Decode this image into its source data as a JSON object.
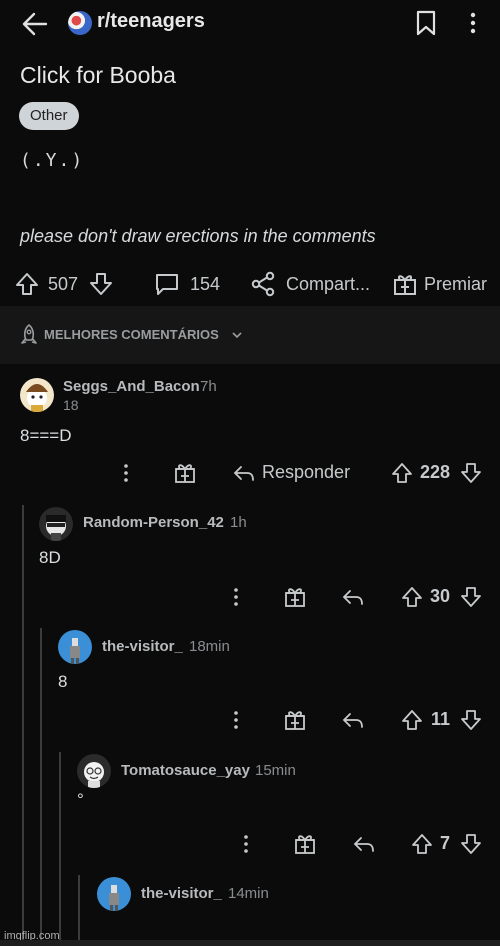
{
  "header": {
    "subreddit": "r/teenagers",
    "icons": {
      "back": "arrow-left-icon",
      "bookmark": "bookmark-icon",
      "more": "more-vertical-icon"
    }
  },
  "post": {
    "title": "Click for Booba",
    "flair": "Other",
    "body": "(.Y.)",
    "note": "please don't draw erections in the comments",
    "votes": "507",
    "comments": "154",
    "share_label": "Compart...",
    "award_label": "Premiar"
  },
  "sort": {
    "label": "MELHORES COMENTÁRIOS"
  },
  "comments": [
    {
      "user": "Seggs_And_Bacon",
      "time": "7h",
      "extra": "18",
      "text": "8===D",
      "reply_label": "Responder",
      "votes": "228"
    },
    {
      "user": "Random-Person_42",
      "time": "1h",
      "text": "8D",
      "votes": "30"
    },
    {
      "user": "the-visitor_",
      "time": "18min",
      "text": "8",
      "votes": "11"
    },
    {
      "user": "Tomatosauce_yay",
      "time": "15min",
      "text": "°",
      "votes": "7"
    },
    {
      "user": "the-visitor_",
      "time": "14min",
      "text": ""
    }
  ],
  "watermark": "imgflip.com",
  "colors": {
    "background": "#0b0b0b",
    "sort_bar": "#161616",
    "flair_bg": "#cfd4d8",
    "text": "#d7dadc"
  }
}
